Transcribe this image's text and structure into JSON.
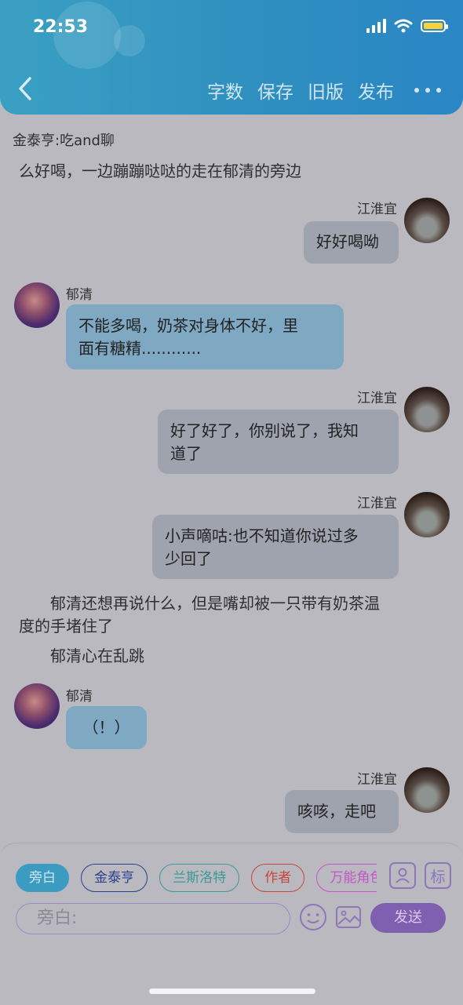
{
  "status": {
    "time": "22:53"
  },
  "header": {
    "menu": [
      "字数",
      "保存",
      "旧版",
      "发布"
    ]
  },
  "chat": {
    "speaker_line": "金泰亨:吃and聊",
    "intro_text": "么好喝，一边蹦蹦哒哒的走在郁清的旁边",
    "msg1": {
      "name": "江淮宜",
      "text": "好好喝呦"
    },
    "msg2": {
      "name": "郁清",
      "line1": "不能多喝，奶茶对身体不好，里",
      "line2": "面有糖精............"
    },
    "msg3": {
      "name": "江淮宜",
      "line1": "好了好了，你别说了，我知",
      "line2": "道了"
    },
    "msg4": {
      "name": "江淮宜",
      "line1": "小声嘀咕:也不知道你说过多",
      "line2": "少回了"
    },
    "narration1": {
      "line1": "郁清还想再说什么，但是嘴却被一只带有奶茶温",
      "line2": "度的手堵住了"
    },
    "narration2": "郁清心在乱跳",
    "msg5": {
      "name": "郁清",
      "text": "（！）"
    },
    "msg6": {
      "name": "江淮宜",
      "text": "咳咳，走吧"
    }
  },
  "panel": {
    "chips": [
      {
        "label": "旁白",
        "color": "#3c9bc0"
      },
      {
        "label": "金泰亨",
        "color": "#2b3f8f"
      },
      {
        "label": "兰斯洛特",
        "color": "#3a9a96"
      },
      {
        "label": "作者",
        "color": "#c8453a"
      },
      {
        "label": "万能角色",
        "color": "#c455c8"
      }
    ],
    "tag_button_label": "标",
    "input_placeholder": "旁白:",
    "send_label": "发送"
  }
}
